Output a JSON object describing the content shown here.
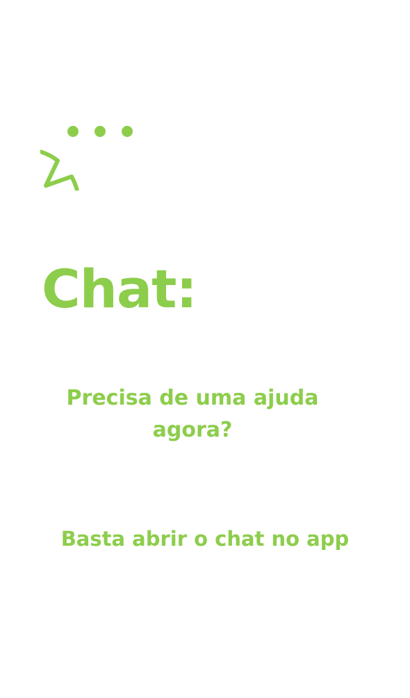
{
  "colors": {
    "accent": "#8dcd4c",
    "background": "#ffffff"
  },
  "icon": {
    "name": "chat-bubble-icon"
  },
  "title": "Chat:",
  "question": "Precisa de uma ajuda agora?",
  "hint": "Basta abrir o chat no app"
}
